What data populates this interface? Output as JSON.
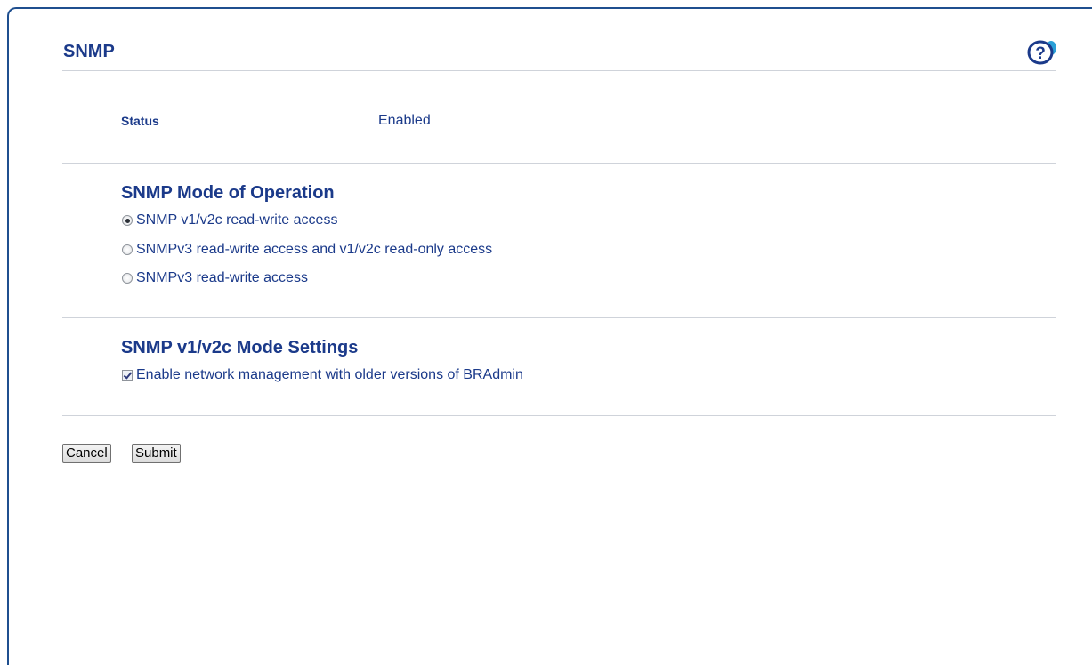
{
  "page": {
    "title": "SNMP"
  },
  "status": {
    "label": "Status",
    "value": "Enabled"
  },
  "mode_of_operation": {
    "title": "SNMP Mode of Operation",
    "options": [
      {
        "label": "SNMP v1/v2c read-write access",
        "selected": true
      },
      {
        "label": "SNMPv3 read-write access and v1/v2c read-only access",
        "selected": false
      },
      {
        "label": "SNMPv3 read-write access",
        "selected": false
      }
    ]
  },
  "v1v2c_settings": {
    "title": "SNMP v1/v2c Mode Settings",
    "checkbox_label": "Enable network management with older versions of BRAdmin",
    "checked": true
  },
  "buttons": {
    "cancel": "Cancel",
    "submit": "Submit"
  },
  "icons": {
    "help": "help-icon"
  },
  "colors": {
    "title_blue": "#1b3a8a",
    "frame_blue": "#1f4f8f",
    "rule_gray": "#cfd3da"
  }
}
